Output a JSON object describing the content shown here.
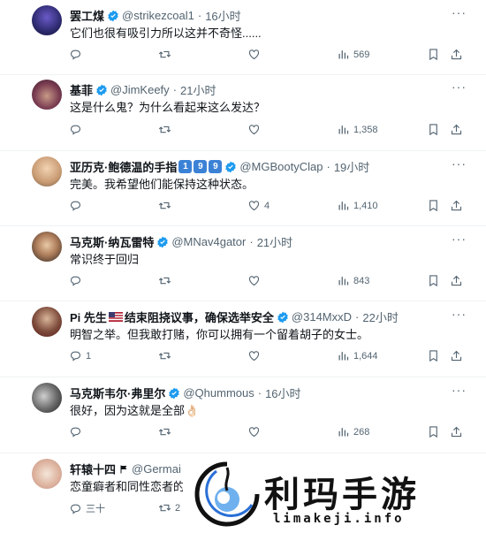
{
  "tweets": [
    {
      "name": "罢工煤",
      "handle": "@strikezcoal1",
      "time": "16小时",
      "text": "它们也很有吸引力所以这并不奇怪......",
      "reply": "",
      "retweet": "",
      "like": "",
      "views": "569",
      "flag": ""
    },
    {
      "name": "基菲",
      "handle": "@JimKeefy",
      "time": "21小时",
      "text": "这是什么鬼？为什么看起来这么发达？",
      "reply": "",
      "retweet": "",
      "like": "",
      "views": "1,358",
      "flag": ""
    },
    {
      "name": "亚历克·鲍德温的手指",
      "keycaps": [
        "1",
        "9",
        "9"
      ],
      "handle": "@MGBootyClap",
      "time": "19小时",
      "text": "完美。我希望他们能保持这种状态。",
      "reply": "",
      "retweet": "",
      "like": "4",
      "views": "1,410",
      "flag": ""
    },
    {
      "name": "马克斯·纳瓦雷特",
      "handle": "@MNav4gator",
      "time": "21小时",
      "text": "常识终于回归",
      "reply": "",
      "retweet": "",
      "like": "",
      "views": "843",
      "flag": ""
    },
    {
      "name_prefix": "Pi 先生",
      "name": "结束阻挠议事，确保选举安全",
      "handle": "@314MxxD",
      "time": "22小时",
      "text": "明智之举。但我敢打赌，你可以拥有一个留着胡子的女士。",
      "reply": "1",
      "retweet": "",
      "like": "",
      "views": "1,644",
      "flag": "us"
    },
    {
      "name": "马克斯韦尔·弗里尔",
      "handle": "@Qhummous",
      "time": "16小时",
      "text": "很好，因为这就是全部👌🏻",
      "reply": "",
      "retweet": "",
      "like": "",
      "views": "268",
      "flag": ""
    },
    {
      "name": "轩辕十四",
      "handle": "@Germai",
      "time": "",
      "text": "恋童癖者和同性恋者的",
      "reply": "三十",
      "retweet": "2",
      "like": "",
      "views": "",
      "flag": ""
    }
  ],
  "watermark": {
    "title": "利玛手游",
    "subtitle": "limakeji.info"
  },
  "colors": {
    "verified": "#1d9bf0",
    "text": "#0f1419",
    "muted": "#536471",
    "divider": "#eff3f4"
  },
  "icons": [
    "reply-icon",
    "retweet-icon",
    "like-icon",
    "views-icon",
    "bookmark-icon",
    "share-icon",
    "more-icon",
    "verified-badge-icon"
  ]
}
